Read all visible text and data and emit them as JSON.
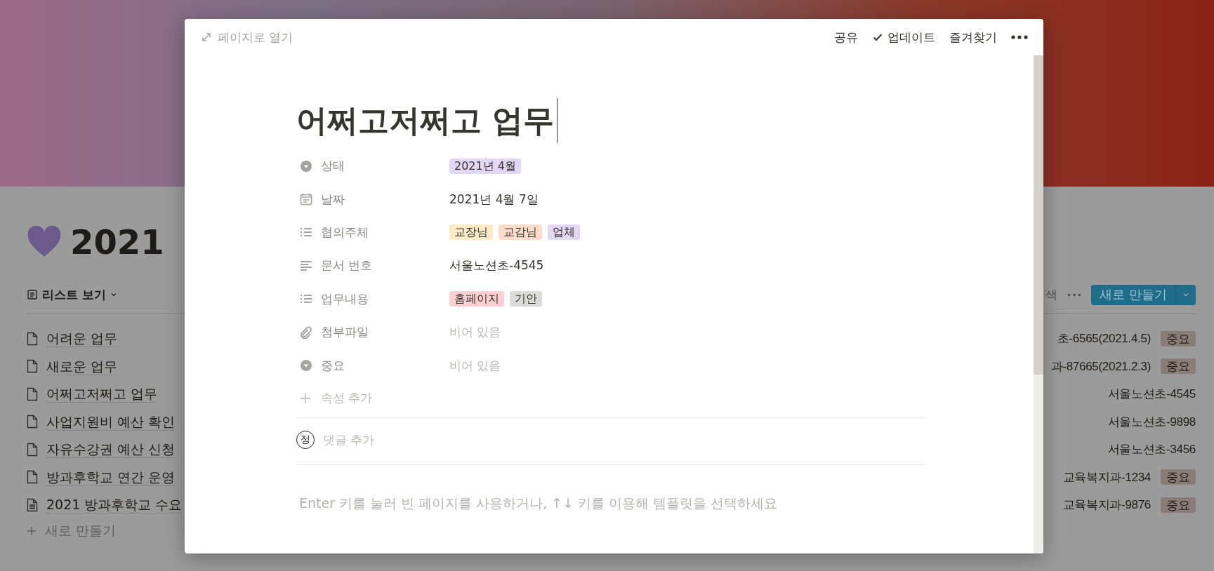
{
  "page": {
    "title": "2021",
    "view": "리스트 보기",
    "toolbar_text": "색",
    "new_button": "새로 만들기",
    "add_label": "새로 만들기",
    "items": [
      {
        "title": "어려운 업무",
        "kind": "page",
        "doc_number": "초-6565(2021.4.5)",
        "tag": "중요"
      },
      {
        "title": "새로운 업무",
        "kind": "page",
        "doc_number": "과-87665(2021.2.3)",
        "tag": "중요"
      },
      {
        "title": "어쩌고저쩌고 업무",
        "kind": "page",
        "doc_number": "서울노션초-4545"
      },
      {
        "title": "사업지원비 예산 확인",
        "kind": "page",
        "doc_number": "서울노션초-9898"
      },
      {
        "title": "자유수강권 예산 신청",
        "kind": "page",
        "doc_number": "서울노션초-3456"
      },
      {
        "title": "방과후학교 연간 운영",
        "kind": "page",
        "doc_number": "교육복지과-1234",
        "tag": "중요"
      },
      {
        "title": "2021 방과후학교 수요",
        "kind": "doc",
        "doc_number": "교육복지과-9876",
        "tag": "중요"
      }
    ]
  },
  "modal": {
    "open_as_page": "페이지로 열기",
    "actions": [
      {
        "label": "공유",
        "kind": "plain"
      },
      {
        "label": "업데이트",
        "kind": "check"
      },
      {
        "label": "즐겨찾기",
        "kind": "plain"
      }
    ],
    "title": "어쩌고저쩌고 업무",
    "properties": [
      {
        "kind": "select",
        "label": "상태",
        "tags": [
          {
            "text": "2021년 4월",
            "color": "#e2d8f5"
          }
        ]
      },
      {
        "kind": "date",
        "label": "날짜",
        "value": "2021년 4월 7일"
      },
      {
        "kind": "multi",
        "label": "협의주체",
        "tags": [
          {
            "text": "교장님",
            "color": "#fbecc7"
          },
          {
            "text": "교감님",
            "color": "#fcdccb"
          },
          {
            "text": "업체",
            "color": "#e2d8f5"
          }
        ]
      },
      {
        "kind": "text",
        "label": "문서 번호",
        "value": "서울노션초-4545"
      },
      {
        "kind": "multi",
        "label": "업무내용",
        "tags": [
          {
            "text": "홈페이지",
            "color": "#ffcfd3"
          },
          {
            "text": "기안",
            "color": "#dbdbda"
          }
        ]
      },
      {
        "kind": "file",
        "label": "첨부파일",
        "placeholder": "비어 있음"
      },
      {
        "kind": "select",
        "label": "중요",
        "placeholder": "비어 있음"
      }
    ],
    "add_property": "속성 추가",
    "comment": {
      "avatar": "정",
      "placeholder": "댓글 추가"
    },
    "hint": "Enter 키를 눌러 빈 페이지를 사용하거나, ↑↓ 키를 이용해 템플릿을 선택하세요"
  }
}
